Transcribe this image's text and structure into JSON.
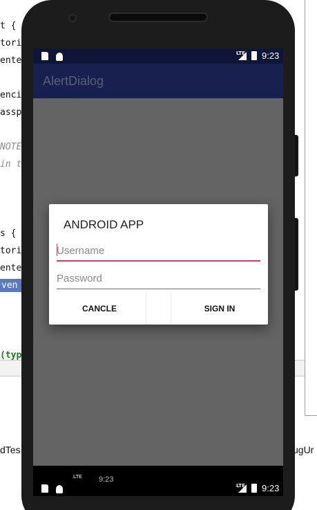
{
  "ide": {
    "code_lines": [
      {
        "text": "t {",
        "cls": ""
      },
      {
        "text": "torie",
        "cls": ""
      },
      {
        "text": "enter",
        "cls": ""
      },
      {
        "text": "encie",
        "cls": ""
      },
      {
        "text": "asspa",
        "cls": ""
      },
      {
        "text": "NOTE",
        "cls": "code-comment"
      },
      {
        "text": "in t",
        "cls": "code-comment"
      },
      {
        "text": "s {",
        "cls": ""
      },
      {
        "text": "torie",
        "cls": ""
      },
      {
        "text": "enter",
        "cls": ""
      },
      {
        "text": "ven",
        "cls": "code-hl"
      },
      {
        "text": "(typ",
        "cls": "code-green"
      }
    ],
    "tab_left": "dTes",
    "tab_right": "ugUr"
  },
  "status_bar": {
    "time": "9:23",
    "network": "LTE"
  },
  "app_bar": {
    "title": "AlertDialog"
  },
  "dialog": {
    "title": "ANDROID APP",
    "username_placeholder": "Username",
    "password_placeholder": "Password",
    "negative_button": "CANCLE",
    "positive_button": "SIGN IN"
  },
  "nav_bar": {
    "ghost_time": "9:23",
    "time": "9:23",
    "network": "LTE"
  },
  "colors": {
    "status_bar": "#0f1538",
    "app_bar": "#182050",
    "accent": "#e2346c",
    "scrim": "#646464"
  },
  "icons": [
    "sd-card-icon",
    "android-icon",
    "signal-icon",
    "battery-icon"
  ]
}
